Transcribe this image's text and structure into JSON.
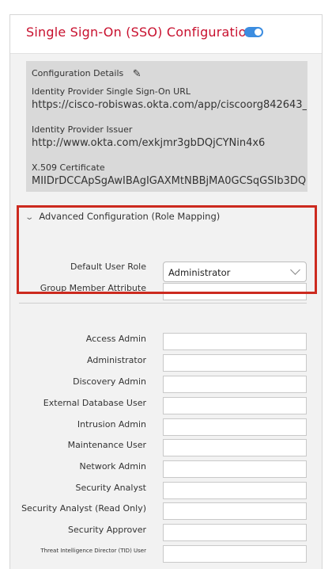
{
  "header": {
    "title": "Single Sign-On (SSO) Configuration",
    "toggle_on": true,
    "accent_color": "#c8102e",
    "toggle_color": "#3c8de0"
  },
  "details": {
    "heading": "Configuration Details",
    "idp_sso_url_label": "Identity Provider Single Sign-On URL",
    "idp_sso_url_value": "https://cisco-robiswas.okta.com/app/ciscoorg842643_",
    "idp_issuer_label": "Identity Provider Issuer",
    "idp_issuer_value": "http://www.okta.com/exkjmr3gbDQjCYNin4x6",
    "cert_label": "X.509 Certificate",
    "cert_value": "MIIDrDCCApSgAwIBAgIGAXMtNBBjMA0GCSqGSIb3DQ"
  },
  "advanced": {
    "heading": "Advanced Configuration (Role Mapping)",
    "default_role_label": "Default User Role",
    "default_role_value": "Administrator",
    "group_member_label": "Group Member Attribute"
  },
  "roles": [
    {
      "label": "Access Admin"
    },
    {
      "label": "Administrator"
    },
    {
      "label": "Discovery Admin"
    },
    {
      "label": "External Database User"
    },
    {
      "label": "Intrusion Admin"
    },
    {
      "label": "Maintenance User"
    },
    {
      "label": "Network Admin"
    },
    {
      "label": "Security Analyst"
    },
    {
      "label": "Security Analyst (Read Only)"
    },
    {
      "label": "Security Approver"
    },
    {
      "label": "Threat Intelligence Director (TID) User"
    }
  ],
  "highlight_color": "#cc2a1f"
}
